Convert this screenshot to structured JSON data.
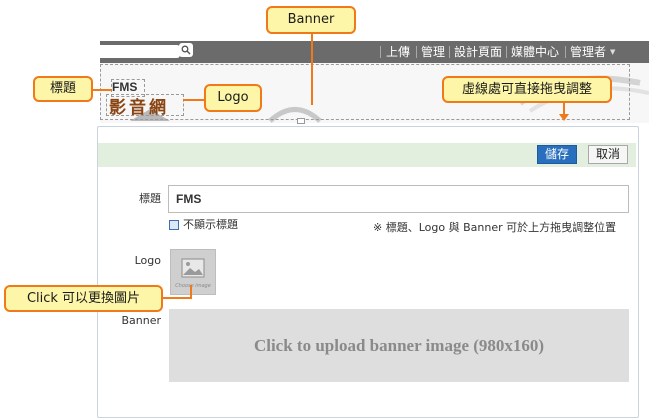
{
  "nav": {
    "items": [
      "上傳",
      "管理",
      "設計頁面",
      "媒體中心",
      "管理者"
    ]
  },
  "site": {
    "title": "FMS",
    "logo_text": "影音網"
  },
  "toolbar": {
    "save_label": "儲存",
    "cancel_label": "取消"
  },
  "form": {
    "title_label": "標題",
    "title_value": "FMS",
    "hide_title_label": "不顯示標題",
    "hint": "※ 標題、Logo 與 Banner 可於上方拖曳調整位置",
    "logo_label": "Logo",
    "logo_placeholder": "Choose image",
    "banner_label": "Banner",
    "banner_upload_text": "Click to upload banner image (980x160)"
  },
  "callouts": {
    "banner": "Banner",
    "title": "標題",
    "logo": "Logo",
    "dashed": "虛線處可直接拖曳調整",
    "click": "Click 可以更換圖片"
  },
  "colors": {
    "accent": "#f07a1a",
    "callout_bg": "#fdf6a8",
    "save_button": "#2a6fbd",
    "toolbar_bg": "#e3efde"
  }
}
